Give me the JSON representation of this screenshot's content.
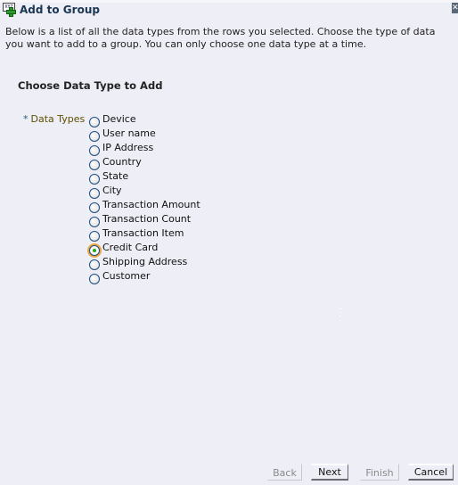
{
  "dialog": {
    "title": "Add to Group",
    "title_icon": "add-to-group-icon",
    "close_icon": "close-icon",
    "close_glyph": "✕",
    "instructions": "Below is a list of all the data types from the rows you selected. Choose the type of data you want to add to a group. You can only choose one data type at a time."
  },
  "form": {
    "section_title": "Choose Data Type to Add",
    "field": {
      "required_marker": "*",
      "label": "Data Types",
      "selected": "Credit Card",
      "options": [
        {
          "label": "Device",
          "checked": false
        },
        {
          "label": "User name",
          "checked": false
        },
        {
          "label": "IP Address",
          "checked": false
        },
        {
          "label": "Country",
          "checked": false
        },
        {
          "label": "State",
          "checked": false
        },
        {
          "label": "City",
          "checked": false
        },
        {
          "label": "Transaction Amount",
          "checked": false
        },
        {
          "label": "Transaction Count",
          "checked": false
        },
        {
          "label": "Transaction Item",
          "checked": false
        },
        {
          "label": "Credit Card",
          "checked": true
        },
        {
          "label": "Shipping Address",
          "checked": false
        },
        {
          "label": "Customer",
          "checked": false
        }
      ]
    }
  },
  "buttons": {
    "back": {
      "label": "Back",
      "enabled": false
    },
    "next": {
      "label": "Next",
      "enabled": true
    },
    "finish": {
      "label": "Finish",
      "enabled": false
    },
    "cancel": {
      "label": "Cancel",
      "enabled": true
    }
  },
  "colors": {
    "background": "#eeeef6",
    "title_text": "#1b3652",
    "field_label": "#5e4f00",
    "required_marker": "#2a5b78",
    "radio_selected_focus": "#e6a84a",
    "radio_dot": "#22aa22"
  }
}
